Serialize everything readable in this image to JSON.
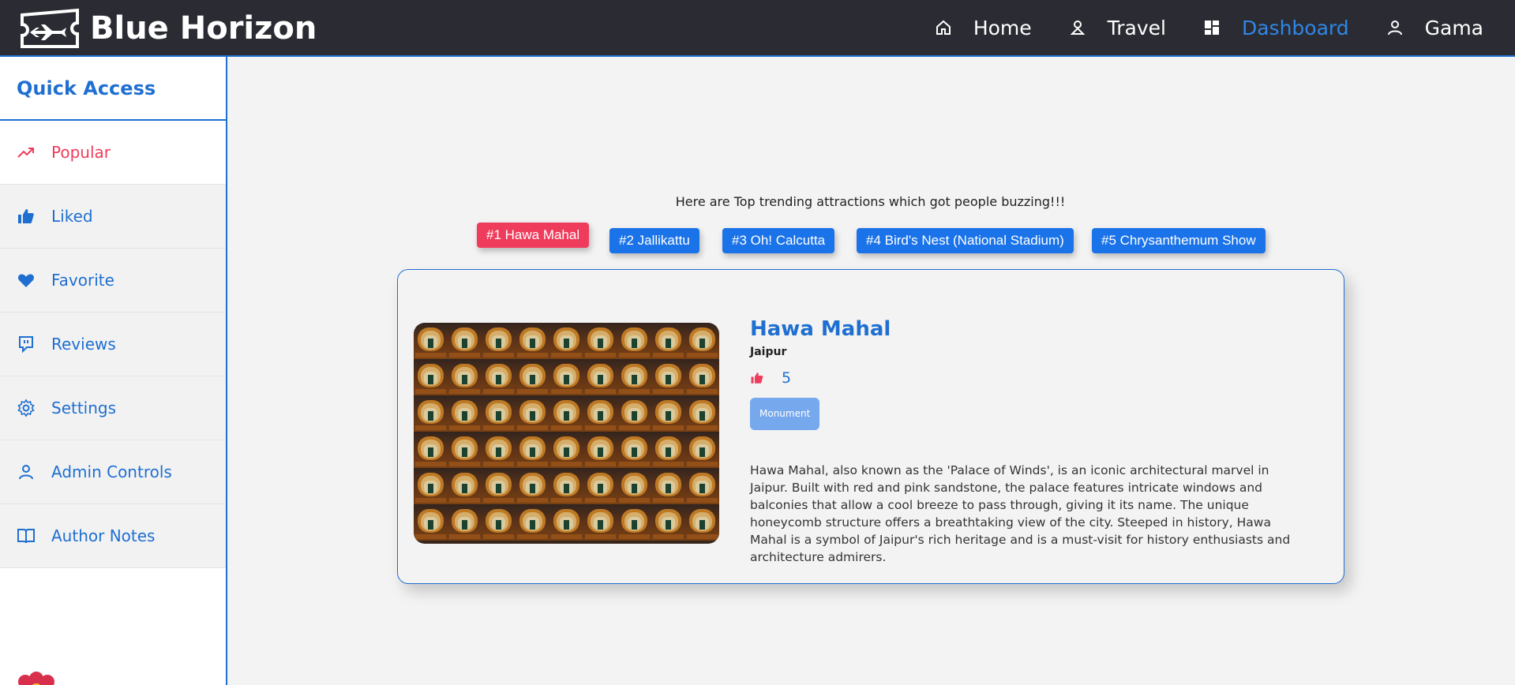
{
  "brand": {
    "name": "Blue Horizon"
  },
  "nav": {
    "items": [
      {
        "label": "Home",
        "icon": "home-icon",
        "active": false
      },
      {
        "label": "Travel",
        "icon": "travel-icon",
        "active": false
      },
      {
        "label": "Dashboard",
        "icon": "dashboard-icon",
        "active": true
      },
      {
        "label": "Gama",
        "icon": "user-icon",
        "active": false
      }
    ]
  },
  "sidebar": {
    "title": "Quick Access",
    "items": [
      {
        "label": "Popular",
        "icon": "trending-icon",
        "active": true
      },
      {
        "label": "Liked",
        "icon": "thumbs-up-icon"
      },
      {
        "label": "Favorite",
        "icon": "heart-icon"
      },
      {
        "label": "Reviews",
        "icon": "reviews-icon"
      },
      {
        "label": "Settings",
        "icon": "gear-icon"
      },
      {
        "label": "Admin Controls",
        "icon": "user-icon"
      },
      {
        "label": "Author Notes",
        "icon": "book-icon"
      }
    ]
  },
  "main": {
    "intro": "Here are Top trending attractions which got people buzzing!!!",
    "chips": [
      {
        "label": "#1 Hawa Mahal",
        "active": true
      },
      {
        "label": "#2 Jallikattu"
      },
      {
        "label": "#3 Oh! Calcutta"
      },
      {
        "label": "#4 Bird's Nest (National Stadium)"
      },
      {
        "label": "#5 Chrysanthemum Show"
      }
    ],
    "card": {
      "title": "Hawa Mahal",
      "city": "Jaipur",
      "likes": "5",
      "tag": "Monument",
      "description": "Hawa Mahal, also known as the 'Palace of Winds', is an iconic architectural marvel in Jaipur. Built with red and pink sandstone, the palace features intricate windows and balconies that allow a cool breeze to pass through, giving it its name. The unique honeycomb structure offers a breathtaking view of the city. Steeped in history, Hawa Mahal is a symbol of Jaipur's rich heritage and is a must-visit for history enthusiasts and architecture admirers."
    }
  },
  "colors": {
    "primary": "#1f6fd1",
    "accent": "#ef3c5c",
    "topbar": "#2b2c33",
    "tag": "#76a8ee"
  }
}
